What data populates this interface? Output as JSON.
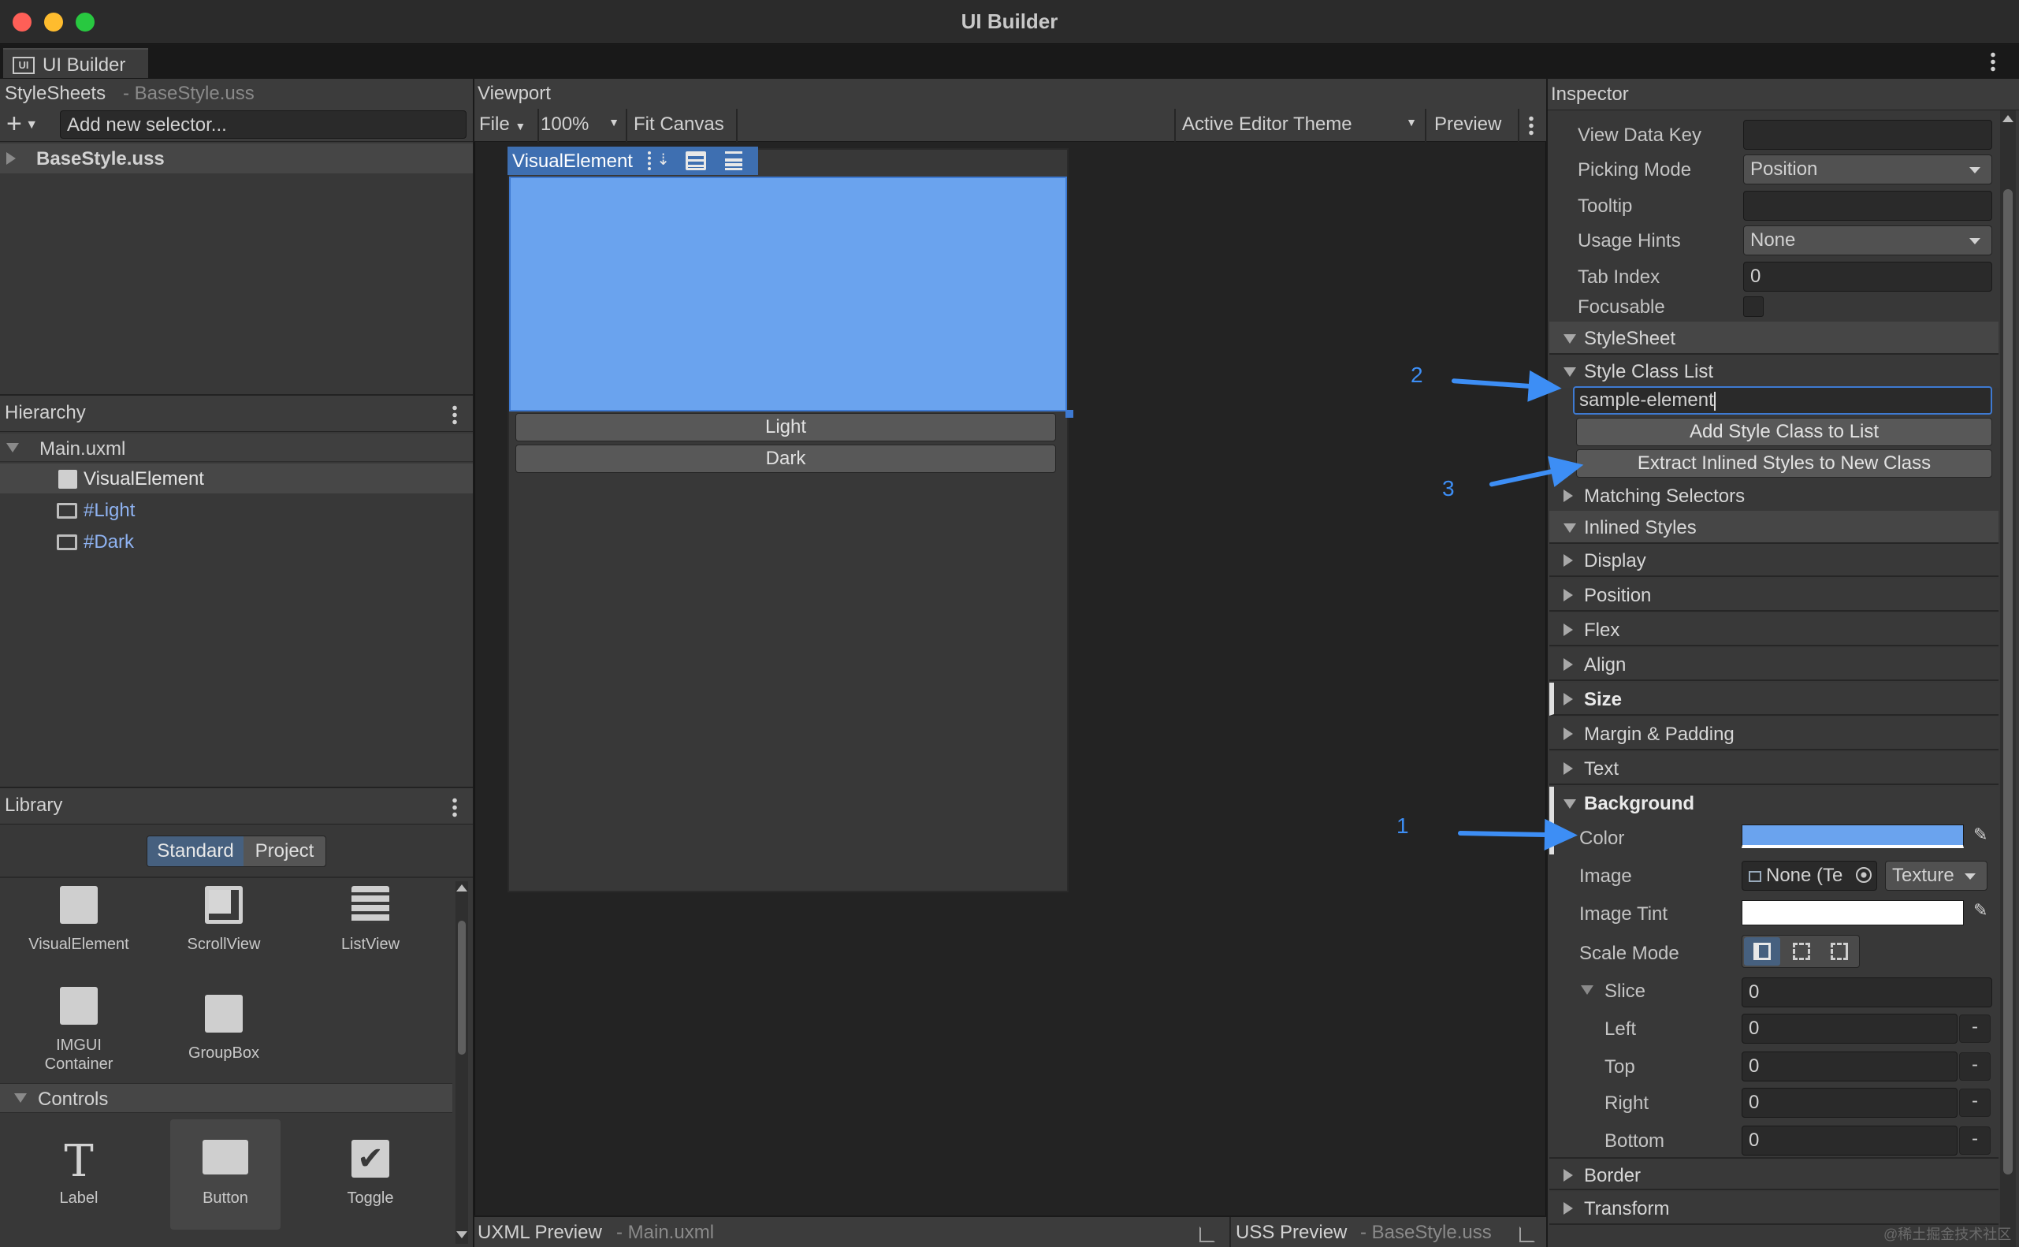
{
  "window": {
    "title": "UI Builder"
  },
  "tab": {
    "label": "UI Builder",
    "icon": "ui-icon"
  },
  "stylesheets": {
    "title": "StyleSheets",
    "subtitle": "- BaseStyle.uss",
    "selector_placeholder": "Add new selector...",
    "item": "BaseStyle.uss"
  },
  "hierarchy": {
    "title": "Hierarchy",
    "root": "Main.uxml",
    "items": [
      {
        "label": "VisualElement"
      },
      {
        "label": "#Light"
      },
      {
        "label": "#Dark"
      }
    ]
  },
  "library": {
    "title": "Library",
    "tabs": [
      "Standard",
      "Project"
    ],
    "items": [
      {
        "label": "VisualElement"
      },
      {
        "label": "ScrollView"
      },
      {
        "label": "ListView"
      },
      {
        "label": "IMGUI Container"
      },
      {
        "label": "GroupBox"
      }
    ],
    "controls_title": "Controls",
    "controls": [
      {
        "label": "Label"
      },
      {
        "label": "Button"
      },
      {
        "label": "Toggle"
      }
    ]
  },
  "viewport": {
    "title": "Viewport",
    "file_menu": "File",
    "zoom": "100%",
    "fit_canvas": "Fit Canvas",
    "theme": "Active Editor Theme",
    "preview": "Preview",
    "selected_label": "VisualElement",
    "buttons": [
      "Light",
      "Dark"
    ],
    "element_color": "#6aa3ee"
  },
  "bottom": {
    "uxml_title": "UXML Preview",
    "uxml_sub": "- Main.uxml",
    "uss_title": "USS Preview",
    "uss_sub": "- BaseStyle.uss"
  },
  "inspector": {
    "title": "Inspector",
    "attrs": [
      {
        "label": "View Data Key",
        "value": ""
      },
      {
        "label": "Picking Mode",
        "value": "Position"
      },
      {
        "label": "Tooltip",
        "value": ""
      },
      {
        "label": "Usage Hints",
        "value": "None"
      },
      {
        "label": "Tab Index",
        "value": "0"
      },
      {
        "label": "Focusable",
        "value": ""
      }
    ],
    "stylesheet_section": "StyleSheet",
    "style_class_list": "Style Class List",
    "class_input": "sample-element",
    "add_class_btn": "Add Style Class to List",
    "extract_btn": "Extract Inlined Styles to New Class",
    "matching": "Matching Selectors",
    "inlined": "Inlined Styles",
    "groups": [
      "Display",
      "Position",
      "Flex",
      "Align",
      "Size",
      "Margin & Padding",
      "Text"
    ],
    "background": {
      "title": "Background",
      "color_label": "Color",
      "color": "#6aa3ee",
      "image_label": "Image",
      "image_value": "None (Te",
      "image_type": "Texture",
      "tint_label": "Image Tint",
      "tint": "#ffffff",
      "scale_label": "Scale Mode",
      "slice_label": "Slice",
      "slice_value": "0",
      "sides": [
        {
          "label": "Left",
          "value": "0"
        },
        {
          "label": "Top",
          "value": "0"
        },
        {
          "label": "Right",
          "value": "0"
        },
        {
          "label": "Bottom",
          "value": "0"
        }
      ]
    },
    "after": [
      "Border",
      "Transform"
    ]
  },
  "annotations": [
    "1",
    "2",
    "3"
  ],
  "watermark": "@稀土掘金技术社区"
}
